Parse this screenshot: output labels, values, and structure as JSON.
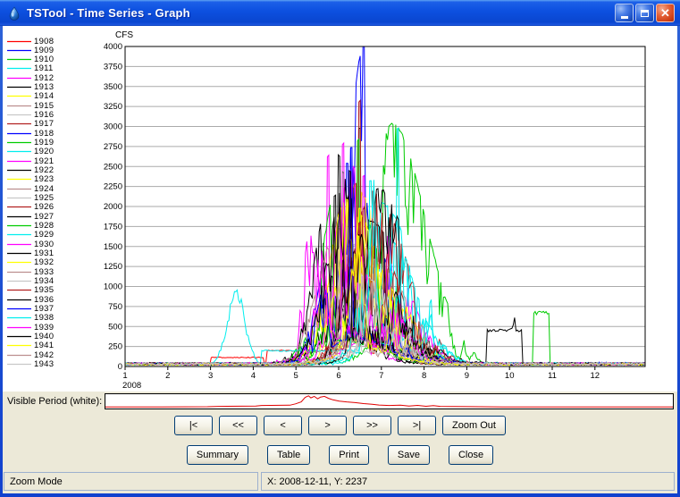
{
  "window": {
    "title": "TSTool - Time Series - Graph",
    "controls": {
      "minimize": "minimize",
      "maximize": "maximize",
      "close": "close"
    }
  },
  "chart_data": {
    "type": "line",
    "title": "",
    "ylabel": "CFS",
    "xlabel": "",
    "x_axis_year": "2008",
    "x_ticks": [
      1,
      2,
      3,
      4,
      5,
      6,
      7,
      8,
      9,
      10,
      11,
      12
    ],
    "x_max": 13.17,
    "ylim": [
      0,
      4000
    ],
    "y_tick_step": 250,
    "grid": "horizontal",
    "legend_position": "left",
    "units": "CFS",
    "note_estimated": true,
    "series": [
      {
        "name": "1908",
        "color": "#FF0000",
        "base_cfs": 40,
        "peak_cfs": 1650,
        "peak_month": 6.15,
        "seed": 11,
        "plateaus": [
          {
            "from": 3.0,
            "to": 4.25,
            "cfs": 115
          },
          {
            "from": 4.3,
            "to": 5.9,
            "cfs": 200
          }
        ]
      },
      {
        "name": "1909",
        "color": "#0000FF",
        "base_cfs": 45,
        "peak_cfs": 3980,
        "peak_month": 6.6,
        "rise": 0.38,
        "fall": 0.5,
        "seed": 22
      },
      {
        "name": "1910",
        "color": "#00CC00",
        "base_cfs": 40,
        "peak_cfs": 3000,
        "peak_month": 7.25,
        "seed": 33
      },
      {
        "name": "1911",
        "color": "#00EEEE",
        "base_cfs": 40,
        "peak_cfs": 1750,
        "peak_month": 6.9,
        "seed": 44,
        "bumps": [
          {
            "month": 3.6,
            "cfs": 950,
            "sigma": 0.22
          }
        ]
      },
      {
        "name": "1912",
        "color": "#FF00FF",
        "base_cfs": 40,
        "peak_cfs": 2600,
        "peak_month": 5.75,
        "seed": 55
      },
      {
        "name": "1913",
        "color": "#000000",
        "base_cfs": 40,
        "peak_cfs": 2950,
        "peak_month": 6.5,
        "seed": 66
      },
      {
        "name": "1914",
        "color": "#FFFF00",
        "base_cfs": 35,
        "peak_cfs": 2250,
        "peak_month": 6.3,
        "seed": 77
      },
      {
        "name": "1915",
        "color": "#BC8F8F",
        "base_cfs": 40,
        "peak_cfs": 1900,
        "peak_month": 6.55,
        "seed": 88
      },
      {
        "name": "1916",
        "color": "#C8C8C8",
        "base_cfs": 40,
        "peak_cfs": 1500,
        "peak_month": 6.35,
        "seed": 99
      },
      {
        "name": "1917",
        "color": "#B22222",
        "base_cfs": 40,
        "peak_cfs": 3300,
        "peak_month": 6.5,
        "rise": 0.32,
        "fall": 0.48,
        "seed": 110
      },
      {
        "name": "1918",
        "color": "#0000FF",
        "base_cfs": 40,
        "peak_cfs": 2500,
        "peak_month": 6.2,
        "seed": 121
      },
      {
        "name": "1919",
        "color": "#00CC00",
        "base_cfs": 40,
        "peak_cfs": 2800,
        "peak_month": 6.45,
        "seed": 132
      },
      {
        "name": "1920",
        "color": "#00EEEE",
        "base_cfs": 40,
        "peak_cfs": 2950,
        "peak_month": 7.4,
        "fall": 0.5,
        "seed": 143
      },
      {
        "name": "1921",
        "color": "#FF00FF",
        "base_cfs": 40,
        "peak_cfs": 2350,
        "peak_month": 6.6,
        "seed": 154
      },
      {
        "name": "1922",
        "color": "#000000",
        "base_cfs": 40,
        "peak_cfs": 2100,
        "peak_month": 5.9,
        "seed": 165
      },
      {
        "name": "1923",
        "color": "#FFFF00",
        "base_cfs": 35,
        "peak_cfs": 1950,
        "peak_month": 6.5,
        "seed": 176
      },
      {
        "name": "1924",
        "color": "#BC8F8F",
        "base_cfs": 40,
        "peak_cfs": 1450,
        "peak_month": 6.7,
        "seed": 187
      },
      {
        "name": "1925",
        "color": "#C8C8C8",
        "base_cfs": 40,
        "peak_cfs": 1350,
        "peak_month": 6.2,
        "seed": 198
      },
      {
        "name": "1926",
        "color": "#B22222",
        "base_cfs": 40,
        "peak_cfs": 2250,
        "peak_month": 6.4,
        "seed": 209
      },
      {
        "name": "1927",
        "color": "#000000",
        "base_cfs": 40,
        "peak_cfs": 2600,
        "peak_month": 6.0,
        "seed": 220
      },
      {
        "name": "1928",
        "color": "#00CC00",
        "base_cfs": 40,
        "peak_cfs": 2400,
        "peak_month": 6.1,
        "seed": 231,
        "plateaus": [
          {
            "from": 10.55,
            "to": 10.95,
            "cfs": 680
          }
        ]
      },
      {
        "name": "1929",
        "color": "#00EEEE",
        "base_cfs": 40,
        "peak_cfs": 2000,
        "peak_month": 7.0,
        "seed": 242,
        "plateaus": [
          {
            "from": 4.2,
            "to": 7.6,
            "cfs": 200
          }
        ]
      },
      {
        "name": "1930",
        "color": "#FF00FF",
        "base_cfs": 40,
        "peak_cfs": 2450,
        "peak_month": 6.35,
        "seed": 253
      },
      {
        "name": "1931",
        "color": "#000000",
        "base_cfs": 40,
        "peak_cfs": 1800,
        "peak_month": 6.7,
        "seed": 264
      },
      {
        "name": "1932",
        "color": "#FFFF00",
        "base_cfs": 35,
        "peak_cfs": 2050,
        "peak_month": 6.2,
        "seed": 275
      },
      {
        "name": "1933",
        "color": "#BC8F8F",
        "base_cfs": 40,
        "peak_cfs": 1700,
        "peak_month": 6.0,
        "seed": 286
      },
      {
        "name": "1934",
        "color": "#C8C8C8",
        "base_cfs": 40,
        "peak_cfs": 1250,
        "peak_month": 6.5,
        "seed": 297
      },
      {
        "name": "1935",
        "color": "#B22222",
        "base_cfs": 40,
        "peak_cfs": 2150,
        "peak_month": 6.8,
        "seed": 308
      },
      {
        "name": "1936",
        "color": "#000000",
        "base_cfs": 40,
        "peak_cfs": 2200,
        "peak_month": 6.9,
        "seed": 319,
        "plateaus": [
          {
            "from": 9.45,
            "to": 10.3,
            "cfs": 460
          }
        ],
        "bumps": [
          {
            "month": 10.1,
            "cfs": 650,
            "sigma": 0.06
          }
        ]
      },
      {
        "name": "1937",
        "color": "#0000FF",
        "base_cfs": 40,
        "peak_cfs": 2700,
        "peak_month": 6.3,
        "seed": 330
      },
      {
        "name": "1938",
        "color": "#00EEEE",
        "base_cfs": 40,
        "peak_cfs": 2300,
        "peak_month": 6.75,
        "seed": 341
      },
      {
        "name": "1939",
        "color": "#FF00FF",
        "base_cfs": 40,
        "peak_cfs": 2750,
        "peak_month": 6.1,
        "seed": 352
      },
      {
        "name": "1940",
        "color": "#000000",
        "base_cfs": 40,
        "peak_cfs": 2400,
        "peak_month": 6.25,
        "seed": 363
      },
      {
        "name": "1941",
        "color": "#FFFF00",
        "base_cfs": 35,
        "peak_cfs": 1600,
        "peak_month": 6.45,
        "seed": 374
      },
      {
        "name": "1942",
        "color": "#BC8F8F",
        "base_cfs": 40,
        "peak_cfs": 1300,
        "peak_month": 6.85,
        "seed": 385
      },
      {
        "name": "1943",
        "color": "#C8C8C8",
        "base_cfs": 40,
        "peak_cfs": 1100,
        "peak_month": 6.55,
        "seed": 396
      }
    ]
  },
  "visible_period": {
    "label": "Visible Period (white):",
    "line_color": "#E00000",
    "points": [
      [
        0,
        0.06
      ],
      [
        0.1,
        0.06
      ],
      [
        0.18,
        0.07
      ],
      [
        0.2,
        0.1
      ],
      [
        0.265,
        0.12
      ],
      [
        0.275,
        0.17
      ],
      [
        0.325,
        0.19
      ],
      [
        0.335,
        0.3
      ],
      [
        0.345,
        0.46
      ],
      [
        0.352,
        0.82
      ],
      [
        0.358,
        0.94
      ],
      [
        0.362,
        0.78
      ],
      [
        0.368,
        0.9
      ],
      [
        0.374,
        0.7
      ],
      [
        0.379,
        0.84
      ],
      [
        0.386,
        0.9
      ],
      [
        0.393,
        0.74
      ],
      [
        0.401,
        0.62
      ],
      [
        0.412,
        0.52
      ],
      [
        0.425,
        0.46
      ],
      [
        0.44,
        0.4
      ],
      [
        0.455,
        0.32
      ],
      [
        0.47,
        0.27
      ],
      [
        0.482,
        0.21
      ],
      [
        0.5,
        0.17
      ],
      [
        0.52,
        0.2
      ],
      [
        0.535,
        0.13
      ],
      [
        0.55,
        0.18
      ],
      [
        0.565,
        0.11
      ],
      [
        0.578,
        0.16
      ],
      [
        0.59,
        0.1
      ],
      [
        0.61,
        0.09
      ],
      [
        0.64,
        0.08
      ],
      [
        0.7,
        0.06
      ],
      [
        0.8,
        0.05
      ],
      [
        0.9,
        0.05
      ],
      [
        1.0,
        0.06
      ]
    ]
  },
  "nav_buttons": [
    {
      "label": "|<"
    },
    {
      "label": "<<"
    },
    {
      "label": "<"
    },
    {
      "label": ">"
    },
    {
      "label": ">>"
    },
    {
      "label": ">|"
    },
    {
      "label": "Zoom Out"
    }
  ],
  "action_buttons": [
    {
      "label": "Summary"
    },
    {
      "label": "Table"
    },
    {
      "label": "Print"
    },
    {
      "label": "Save"
    },
    {
      "label": "Close"
    }
  ],
  "status_bar": {
    "mode": "Zoom Mode",
    "coordinates": "X: 2008-12-11, Y: 2237"
  },
  "colors": {
    "titlebar_blue": "#0D50E0",
    "window_border": "#1141CE",
    "client_bg": "#ECE9D8",
    "plot_bg": "#FFFFFF",
    "gridline": "#AAAAAA",
    "axis": "#000000",
    "close_red": "#CC3C12"
  }
}
